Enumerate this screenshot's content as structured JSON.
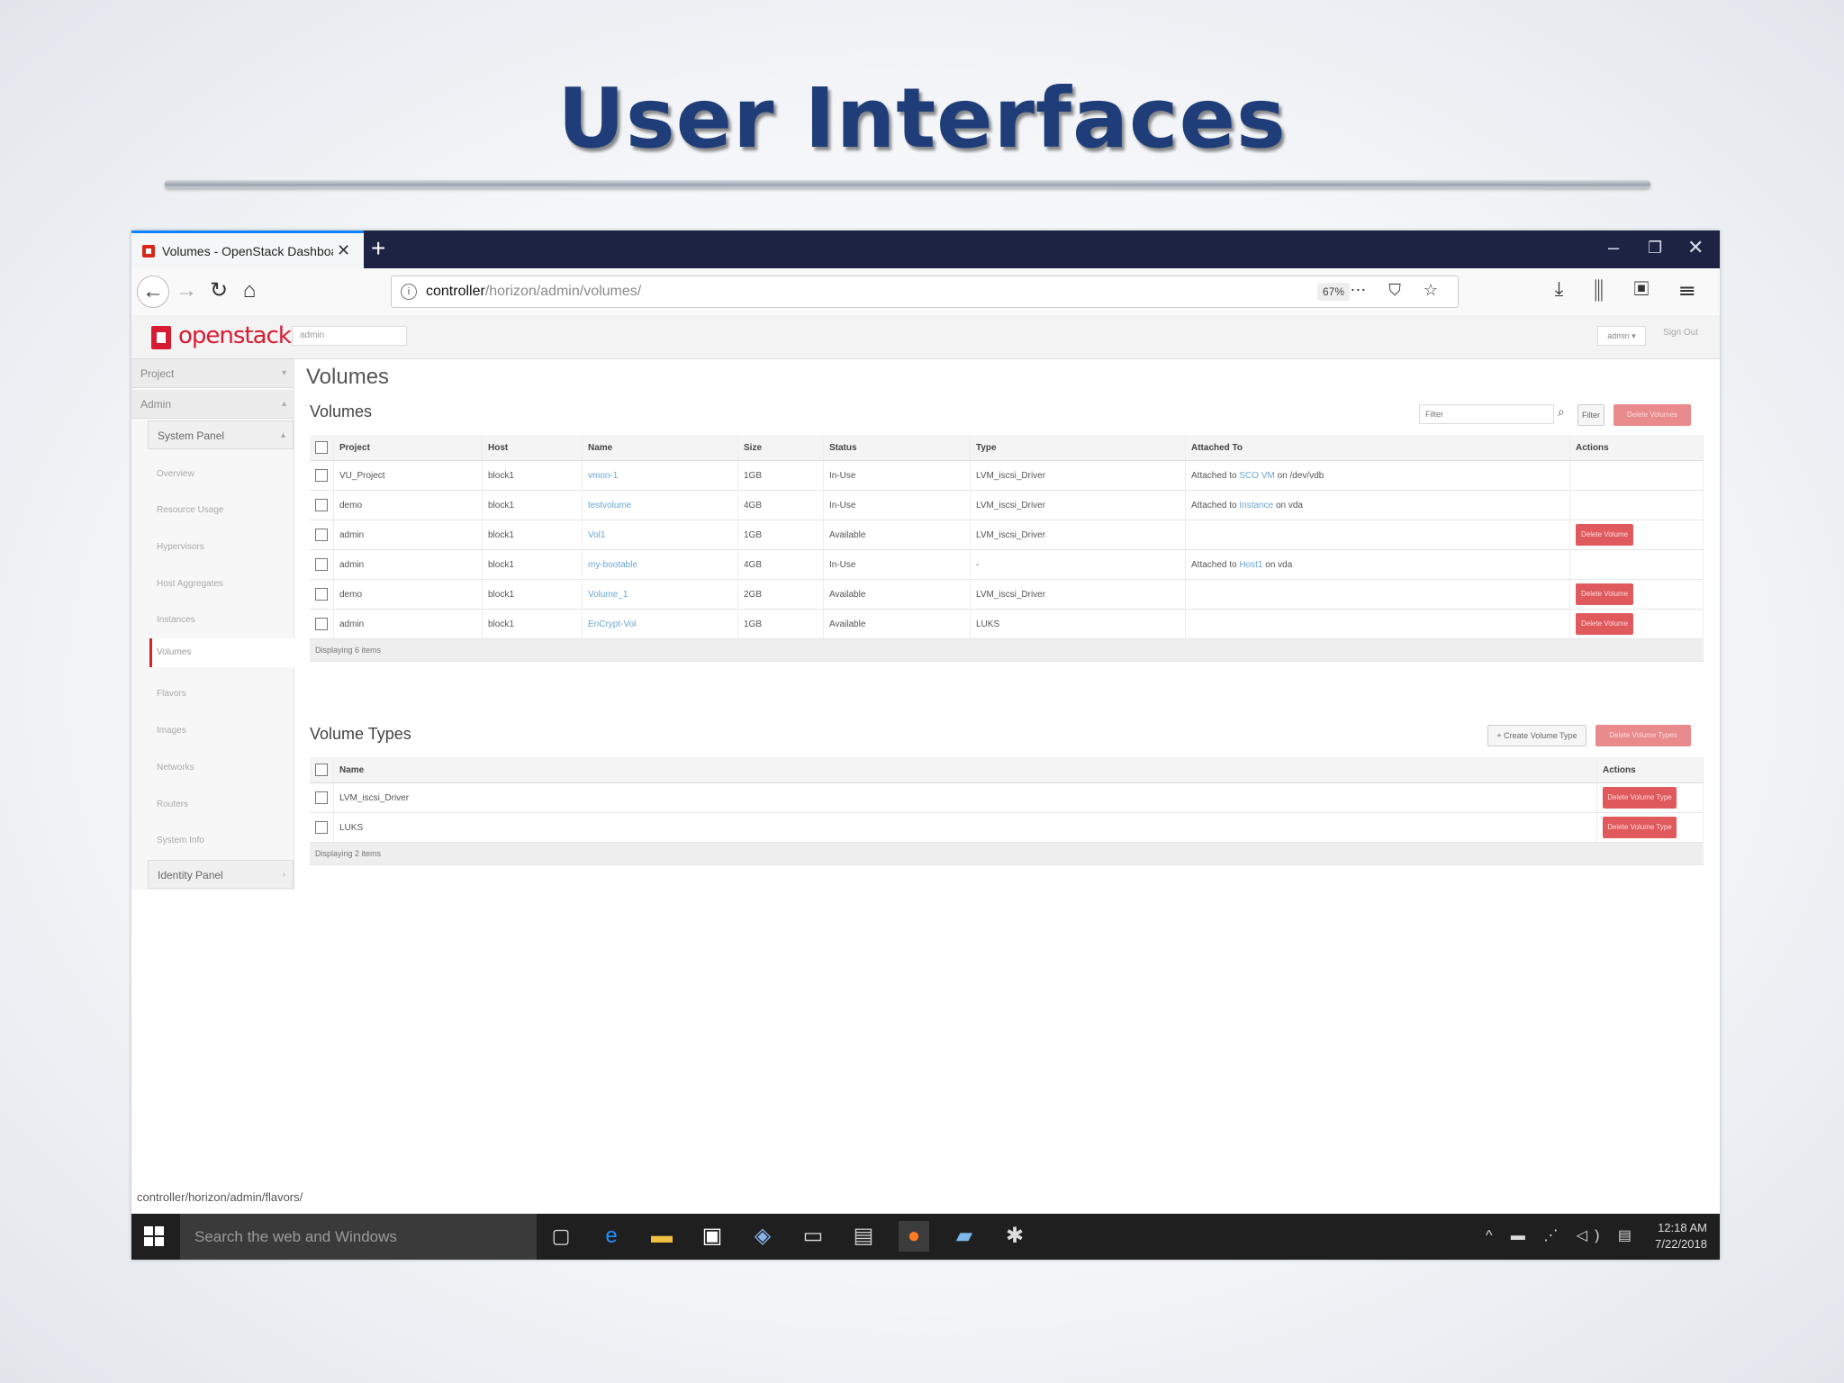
{
  "slide": {
    "title": "User Interfaces"
  },
  "browser": {
    "tab_title": "Volumes - OpenStack Dashboard",
    "tab_close": "✕",
    "new_tab": "+",
    "window_controls": {
      "minimize": "–",
      "restore": "❐",
      "close": "✕"
    },
    "url_host": "controller",
    "url_path": "/horizon/admin/volumes/",
    "zoom": "67%",
    "url_icons": "⋯ ⛉ ☆",
    "toolbar_icons": "⤓ ⫼ ▣ ☰",
    "status_url": "controller/horizon/admin/flavors/"
  },
  "openstack": {
    "logo": "openstack",
    "project_select": "admin",
    "user_menu": "admin ▾",
    "sign_out": "Sign Out",
    "sidebar": {
      "project": "Project",
      "admin": "Admin",
      "system_panel": "System Panel",
      "identity_panel": "Identity Panel",
      "links": [
        "Overview",
        "Resource Usage",
        "Hypervisors",
        "Host Aggregates",
        "Instances",
        "Volumes",
        "Flavors",
        "Images",
        "Networks",
        "Routers",
        "System Info"
      ]
    },
    "page_title": "Volumes",
    "volumes": {
      "title": "Volumes",
      "filter_placeholder": "Filter",
      "filter_button": "Filter",
      "delete_button": "Delete Volumes",
      "columns": [
        "Project",
        "Host",
        "Name",
        "Size",
        "Status",
        "Type",
        "Attached To",
        "Actions"
      ],
      "rows": [
        {
          "project": "VU_Project",
          "host": "block1",
          "name": "vmon-1",
          "size": "1GB",
          "status": "In-Use",
          "type": "LVM_iscsi_Driver",
          "attached_prefix": "Attached to",
          "attached_link": "SCO VM",
          "attached_suffix": "on /dev/vdb",
          "action": ""
        },
        {
          "project": "demo",
          "host": "block1",
          "name": "testvolume",
          "size": "4GB",
          "status": "In-Use",
          "type": "LVM_iscsi_Driver",
          "attached_prefix": "Attached to",
          "attached_link": "Instance",
          "attached_suffix": "on vda",
          "action": ""
        },
        {
          "project": "admin",
          "host": "block1",
          "name": "Vol1",
          "size": "1GB",
          "status": "Available",
          "type": "LVM_iscsi_Driver",
          "attached_prefix": "",
          "attached_link": "",
          "attached_suffix": "",
          "action": "Delete Volume"
        },
        {
          "project": "admin",
          "host": "block1",
          "name": "my-bootable",
          "size": "4GB",
          "status": "In-Use",
          "type": "-",
          "attached_prefix": "Attached to",
          "attached_link": "Host1",
          "attached_suffix": "on vda",
          "action": ""
        },
        {
          "project": "demo",
          "host": "block1",
          "name": "Volume_1",
          "size": "2GB",
          "status": "Available",
          "type": "LVM_iscsi_Driver",
          "attached_prefix": "",
          "attached_link": "",
          "attached_suffix": "",
          "action": "Delete Volume"
        },
        {
          "project": "admin",
          "host": "block1",
          "name": "EnCrypt-Vol",
          "size": "1GB",
          "status": "Available",
          "type": "LUKS",
          "attached_prefix": "",
          "attached_link": "",
          "attached_suffix": "",
          "action": "Delete Volume"
        }
      ],
      "footer": "Displaying 6 items"
    },
    "volume_types": {
      "title": "Volume Types",
      "create_button": "+ Create Volume Type",
      "delete_button": "Delete Volume Types",
      "columns": [
        "Name",
        "Actions"
      ],
      "rows": [
        {
          "name": "LVM_iscsi_Driver",
          "action": "Delete Volume Type"
        },
        {
          "name": "LUKS",
          "action": "Delete Volume Type"
        }
      ],
      "footer": "Displaying 2 items"
    }
  },
  "taskbar": {
    "search_placeholder": "Search the web and Windows",
    "time": "12:18 AM",
    "date": "7/22/2018",
    "tray_icons": "^ ▬ ⋰ ◁) ▤"
  },
  "colors": {
    "title": "#1f3d78",
    "openstack_red": "#da1a32",
    "delete_red": "#e0595c",
    "tab_bar": "#1d2342",
    "link": "#6aa6d6"
  }
}
